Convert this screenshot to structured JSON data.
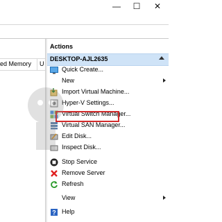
{
  "window": {
    "minimize_glyph": "—",
    "maximize_glyph": "☐",
    "close_glyph": "✕"
  },
  "grid": {
    "columns": [
      "ed Memory",
      "U"
    ]
  },
  "actions": {
    "title": "Actions",
    "section": "DESKTOP-AJL2635",
    "items": [
      {
        "label": "Quick Create...",
        "icon": "quick-create-icon"
      },
      {
        "label": "New",
        "icon": "blank",
        "submenu": true
      },
      {
        "label": "Import Virtual Machine...",
        "icon": "import-vm-icon"
      },
      {
        "label": "Hyper-V Settings...",
        "icon": "settings-icon"
      },
      {
        "label": "Virtual Switch Manager...",
        "icon": "switch-manager-icon"
      },
      {
        "label": "Virtual SAN Manager...",
        "icon": "san-manager-icon"
      },
      {
        "label": "Edit Disk...",
        "icon": "edit-disk-icon"
      },
      {
        "label": "Inspect Disk...",
        "icon": "inspect-disk-icon"
      },
      {
        "label": "Stop Service",
        "icon": "stop-icon"
      },
      {
        "label": "Remove Server",
        "icon": "remove-icon"
      },
      {
        "label": "Refresh",
        "icon": "refresh-icon"
      },
      {
        "label": "View",
        "icon": "blank",
        "submenu": true
      },
      {
        "label": "Help",
        "icon": "help-icon"
      }
    ]
  },
  "highlight_color": "#d22c2c"
}
